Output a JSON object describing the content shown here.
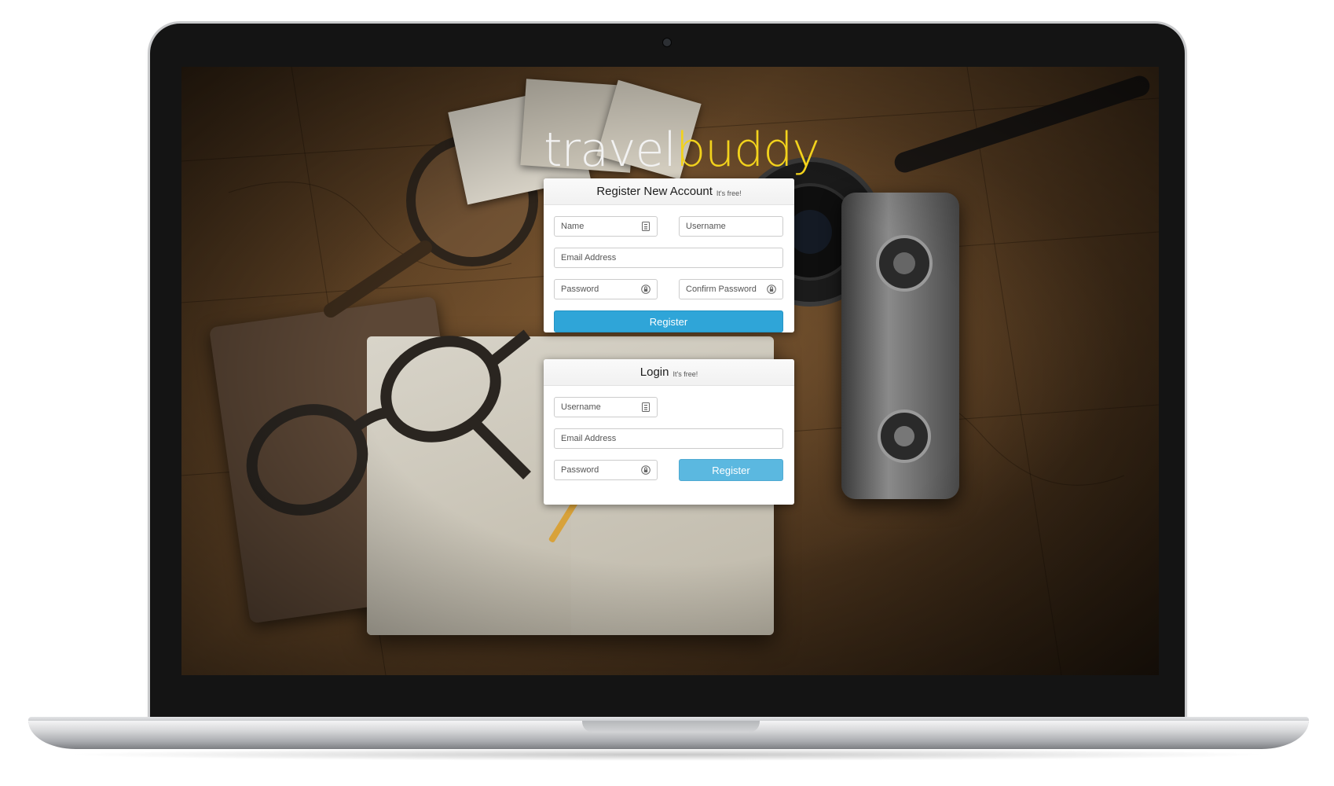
{
  "logo": {
    "part1": "travel",
    "part2": "buddy"
  },
  "register": {
    "title": "Register New Account",
    "subtitle": "It's free!",
    "name_placeholder": "Name",
    "username_placeholder": "Username",
    "email_placeholder": "Email Address",
    "password_placeholder": "Password",
    "confirm_password_placeholder": "Confirm Password",
    "submit_label": "Register"
  },
  "login": {
    "title": "Login",
    "subtitle": "It's free!",
    "username_placeholder": "Username",
    "email_placeholder": "Email Address",
    "password_placeholder": "Password",
    "submit_label": "Register"
  },
  "icons": {
    "id_card": "id-card-icon",
    "lock": "lock-icon"
  },
  "colors": {
    "accent": "#2fa5d8",
    "accent_light": "#5bb8e0",
    "logo_yellow": "#f2d21c"
  }
}
